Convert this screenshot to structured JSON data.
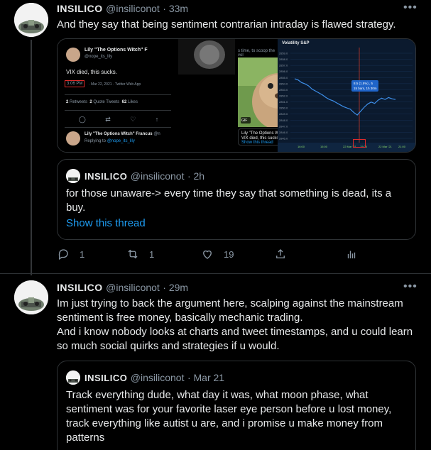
{
  "tweet1": {
    "name": "INSILICO",
    "handle": "@insiliconot",
    "time": "· 33m",
    "text": "And they say that being sentiment contrarian intraday is flawed strategy.",
    "media": {
      "left": {
        "name": "Lily \"The Options Witch\" F",
        "handle": "@nope_its_lily",
        "text": "VIX died, this sucks.",
        "time": "3:06 PM",
        "date": "· Mar 22, 2021 · Twitter Web App",
        "retweets": "2",
        "retweets_label": "Retweets",
        "quotes": "2",
        "quotes_label": "Quote Tweets",
        "likes": "62",
        "likes_label": "Likes",
        "reply_name": "Lily \"The Options Witch\" Francus",
        "reply_handle": "@n",
        "replying": "Replying to",
        "replying_handle": "@nope_its_lily"
      },
      "middle": {
        "caption": "s time, to scoop the vol",
        "gif_label": "GIF",
        "quoted_name": "Lily \"The Options Witch\" Francus",
        "quoted_text": "VIX died, this sucks.",
        "quoted_link": "Show this thread"
      },
      "right": {
        "title": "Volatility S&P",
        "ticks": [
          "2859.0",
          "2858.0",
          "2857.0",
          "2856.0",
          "2855.0",
          "2854.0",
          "2853.0",
          "2852.0",
          "2851.0",
          "2850.0",
          "2849.0",
          "2848.0",
          "2847.0",
          "2846.0",
          "2845.0"
        ],
        "tooltip1": "8.5 (1.5%) , 5",
        "tooltip2": "15 bars, 1h 30m",
        "times": [
          "16:00",
          "15:00",
          "22 Mar '21",
          "15:05",
          "22 Mar '21",
          "21:00"
        ]
      }
    }
  },
  "quote1": {
    "name": "INSILICO",
    "handle": "@insiliconot",
    "time": "· 2h",
    "text": "for those unaware-> every time they say that something is dead, its a buy.",
    "link": "Show this thread"
  },
  "actions": {
    "replies": "1",
    "retweets": "1",
    "likes": "19"
  },
  "tweet2": {
    "name": "INSILICO",
    "handle": "@insiliconot",
    "time": "· 29m",
    "text_lines": [
      "Im just trying to back the argument here, scalping against the mainstream",
      "sentiment is free money, basically mechanic trading.",
      "And i know nobody looks at charts and tweet timestamps, and u could learn",
      "so much social quirks and strategies if u would."
    ]
  },
  "quote2": {
    "name": "INSILICO",
    "handle": "@insiliconot",
    "time": "· Mar 21",
    "text_lines": [
      "Track everything dude, what day it was, what moon phase, what",
      "sentiment was for your favorite laser eye person before u lost money,",
      "track everything like autist u are, and i promise u make money from",
      "patterns"
    ]
  },
  "more_label": "•••",
  "colors": {
    "accent": "#1d9bf0",
    "chart_line": "#3d8ee8",
    "chart_bg": "#0b1a2e"
  },
  "chart_data": {
    "type": "line",
    "title": "Volatility S&P",
    "x": [
      0,
      5,
      10,
      15,
      20,
      25,
      30,
      35,
      40,
      45,
      50,
      55,
      60,
      65,
      70,
      75,
      80,
      85,
      90,
      95,
      100,
      105,
      110,
      115,
      120,
      125,
      130,
      135,
      140,
      145
    ],
    "values": [
      2854.2,
      2854.0,
      2853.6,
      2853.4,
      2853.1,
      2852.6,
      2852.3,
      2852.0,
      2851.7,
      2851.3,
      2851.0,
      2850.8,
      2850.5,
      2850.2,
      2849.9,
      2849.7,
      2849.5,
      2849.0,
      2848.6,
      2849.2,
      2849.8,
      2850.3,
      2850.6,
      2850.4,
      2850.9,
      2851.2,
      2851.0,
      2851.3,
      2851.1,
      2851.0
    ],
    "ylim": [
      2845,
      2859
    ]
  }
}
